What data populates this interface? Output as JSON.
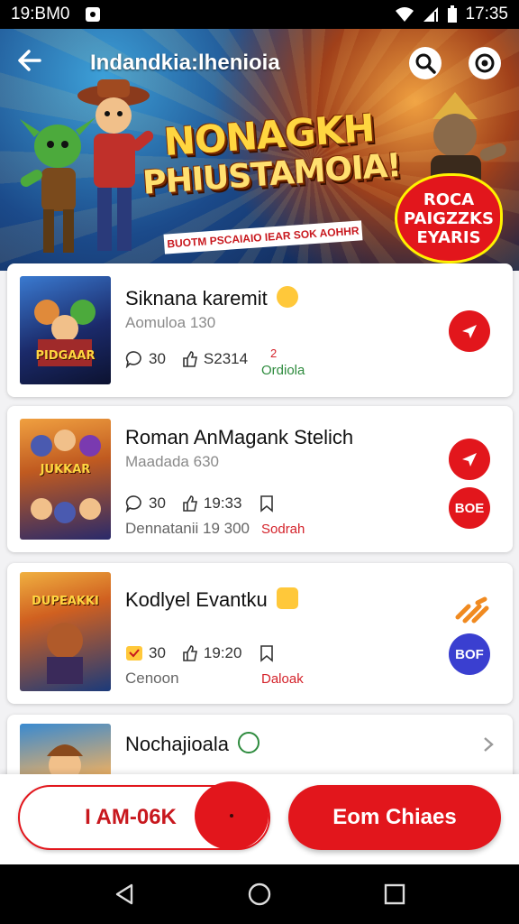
{
  "status_bar": {
    "time_left": "19:BM0",
    "time_right": "17:35"
  },
  "header": {
    "title": "Indandkia:lhenioia"
  },
  "banner": {
    "title_line1": "NONAGKH",
    "title_line2": "PHIUSTAMOIA!",
    "subtitle": "BUOTM PSCAIAIO IEAR SOK AOHHR",
    "promo_line1": "ROCA",
    "promo_line2": "PAIGZZKS",
    "promo_line3": "EYARIS"
  },
  "items": [
    {
      "title": "Siknana karemit",
      "subtitle": "Aomuloa 130",
      "comments": "30",
      "likes": "S2314",
      "tag_top": "2",
      "tag": "Ordiola",
      "thumb_title": "PIDGAAR"
    },
    {
      "title": "Roman AnMagank Stelich",
      "subtitle": "Maadada 630",
      "comments": "30",
      "likes": "19:33",
      "extra": "Dennatanii 19 300",
      "tag": "Sodrah",
      "badge": "BOE",
      "thumb_title": "JUKKAR"
    },
    {
      "title": "Kodlyel Evantku",
      "subtitle": "Cenoon",
      "comments": "30",
      "likes": "19:20",
      "tag": "Daloak",
      "badge": "BOF",
      "thumb_title": "DUPEAKKI"
    },
    {
      "title": "Nochajioala",
      "thumb_title": ""
    }
  ],
  "actions": {
    "secondary_label": "I AM-06K",
    "primary_label": "Eom Chiaes"
  },
  "colors": {
    "accent": "#e2161c",
    "tag_green": "#2e8b3e",
    "tag_red": "#d4222a",
    "badge_blue": "#3a3fd0"
  }
}
